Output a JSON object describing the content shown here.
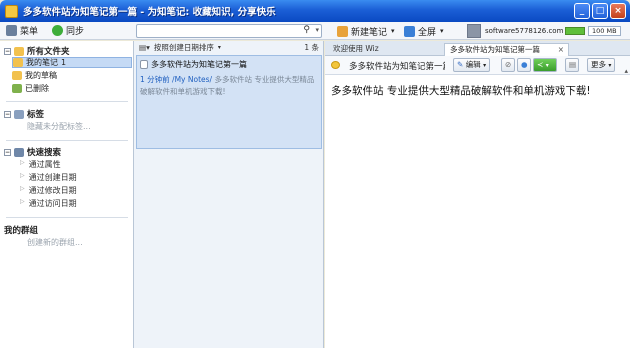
{
  "window": {
    "title": "多多软件站为知笔记第一篇 - 为知笔记: 收藏知识, 分享快乐",
    "buttons": {
      "minimize": "_",
      "maximize": "□",
      "close": "×"
    }
  },
  "toolbar": {
    "menu_label": "菜单",
    "sync_label": "同步",
    "search": {
      "placeholder": "",
      "icon": "search-icon"
    },
    "new_note_label": "新建笔记",
    "fullscreen_label": "全屏",
    "username": "software5778126.com",
    "storage_label": "100 MB"
  },
  "sidebar": {
    "all_folders": "所有文件夹",
    "folders": [
      {
        "label": "我的笔记",
        "count": "1",
        "selected": true
      },
      {
        "label": "我的草稿",
        "count": ""
      },
      {
        "label": "已删除",
        "count": ""
      }
    ],
    "tags_header": "标签",
    "tags_hint": "隐藏未分配标签...",
    "quick_search_header": "快速搜索",
    "quick_search_items": [
      "通过属性",
      "通过创建日期",
      "通过修改日期",
      "通过访问日期"
    ],
    "groups_header": "我的群组",
    "groups_hint": "创建新的群组..."
  },
  "notelist": {
    "sort_label": "按照创建日期排序",
    "count": "1 条",
    "notes": [
      {
        "title": "多多软件站为知笔记第一篇",
        "time": "1 分钟前",
        "path": "/My Notes/",
        "snippet_part1": "多多软件站 专业提供大型精品",
        "snippet_part2": "破解软件和单机游戏下载!"
      }
    ]
  },
  "editor": {
    "tabs": [
      {
        "label": "欢迎使用 Wiz"
      },
      {
        "label": "多多软件站为知笔记第一篇",
        "active": true
      }
    ],
    "note_title": "多多软件站为知笔记第一篇",
    "edit_label": "编辑",
    "more_label": "更多",
    "content": "多多软件站 专业提供大型精品破解软件和单机游戏下载!"
  }
}
